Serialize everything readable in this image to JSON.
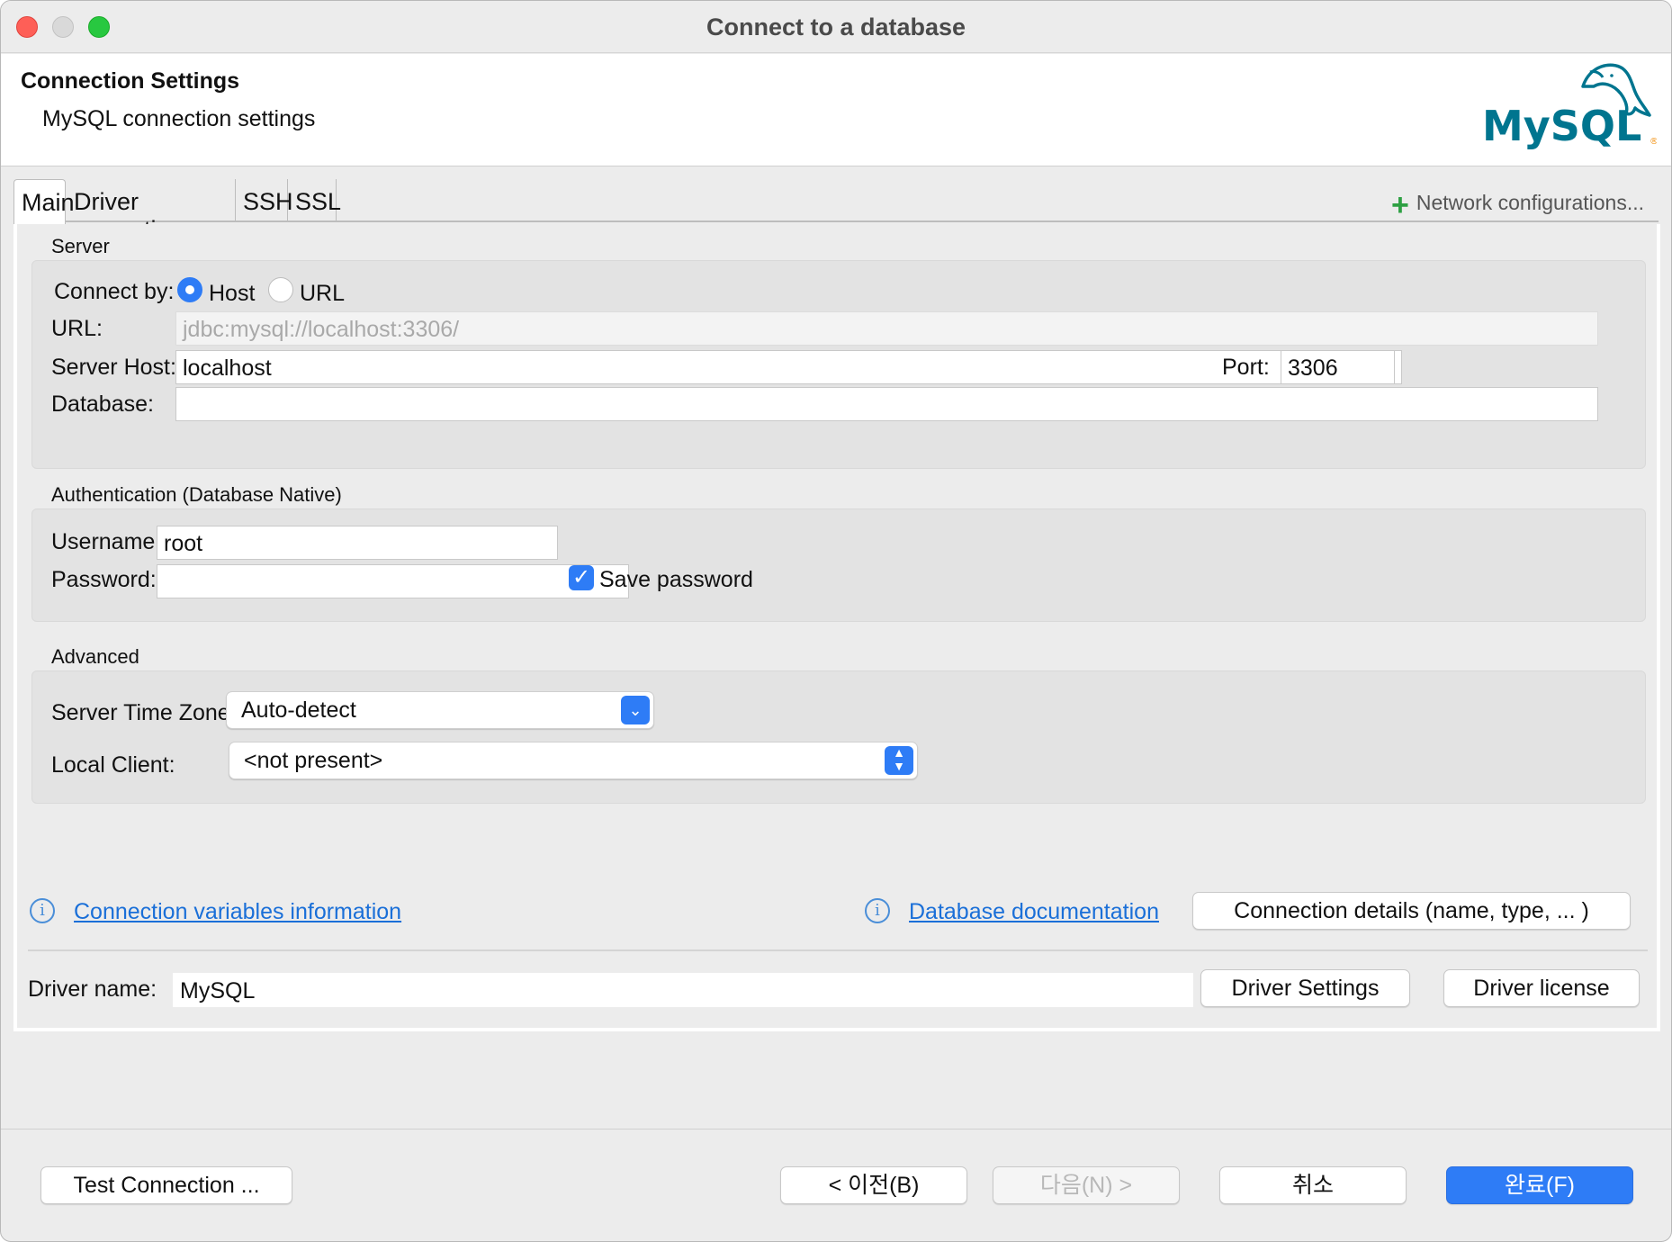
{
  "window": {
    "title": "Connect to a database"
  },
  "banner": {
    "title": "Connection Settings",
    "subtitle": "MySQL connection settings",
    "logo_text": "MySQL"
  },
  "tabs": [
    {
      "label": "Main",
      "active": true
    },
    {
      "label": "Driver properties"
    },
    {
      "label": "SSH"
    },
    {
      "label": "SSL"
    }
  ],
  "network_config": {
    "label": "Network configurations..."
  },
  "server": {
    "section": "Server",
    "connect_by_label": "Connect by:",
    "host_option": "Host",
    "url_option": "URL",
    "selected": "Host",
    "url_label": "URL:",
    "url_value": "jdbc:mysql://localhost:3306/",
    "host_label": "Server Host:",
    "host_value": "localhost",
    "port_label": "Port:",
    "port_value": "3306",
    "database_label": "Database:",
    "database_value": ""
  },
  "auth": {
    "section": "Authentication (Database Native)",
    "username_label": "Username:",
    "username_value": "root",
    "password_label": "Password:",
    "password_value": "",
    "save_password_label": "Save password",
    "save_password_checked": true
  },
  "advanced": {
    "section": "Advanced",
    "timezone_label": "Server Time Zone:",
    "timezone_value": "Auto-detect",
    "local_client_label": "Local Client:",
    "local_client_value": "<not present>"
  },
  "links": {
    "conn_vars": "Connection variables information",
    "db_docs": "Database documentation",
    "conn_details_button": "Connection details (name, type, ... )"
  },
  "driver": {
    "name_label": "Driver name:",
    "name_value": "MySQL",
    "settings_button": "Driver Settings",
    "license_button": "Driver license"
  },
  "footer": {
    "test_button": "Test Connection ...",
    "back_button": "< 이전(B)",
    "next_button": "다음(N) >",
    "cancel_button": "취소",
    "finish_button": "완료(F)"
  },
  "colors": {
    "accent": "#2e7cf6",
    "link": "#1a6fd8",
    "logo_blue": "#00758f",
    "logo_orange": "#f29111"
  }
}
